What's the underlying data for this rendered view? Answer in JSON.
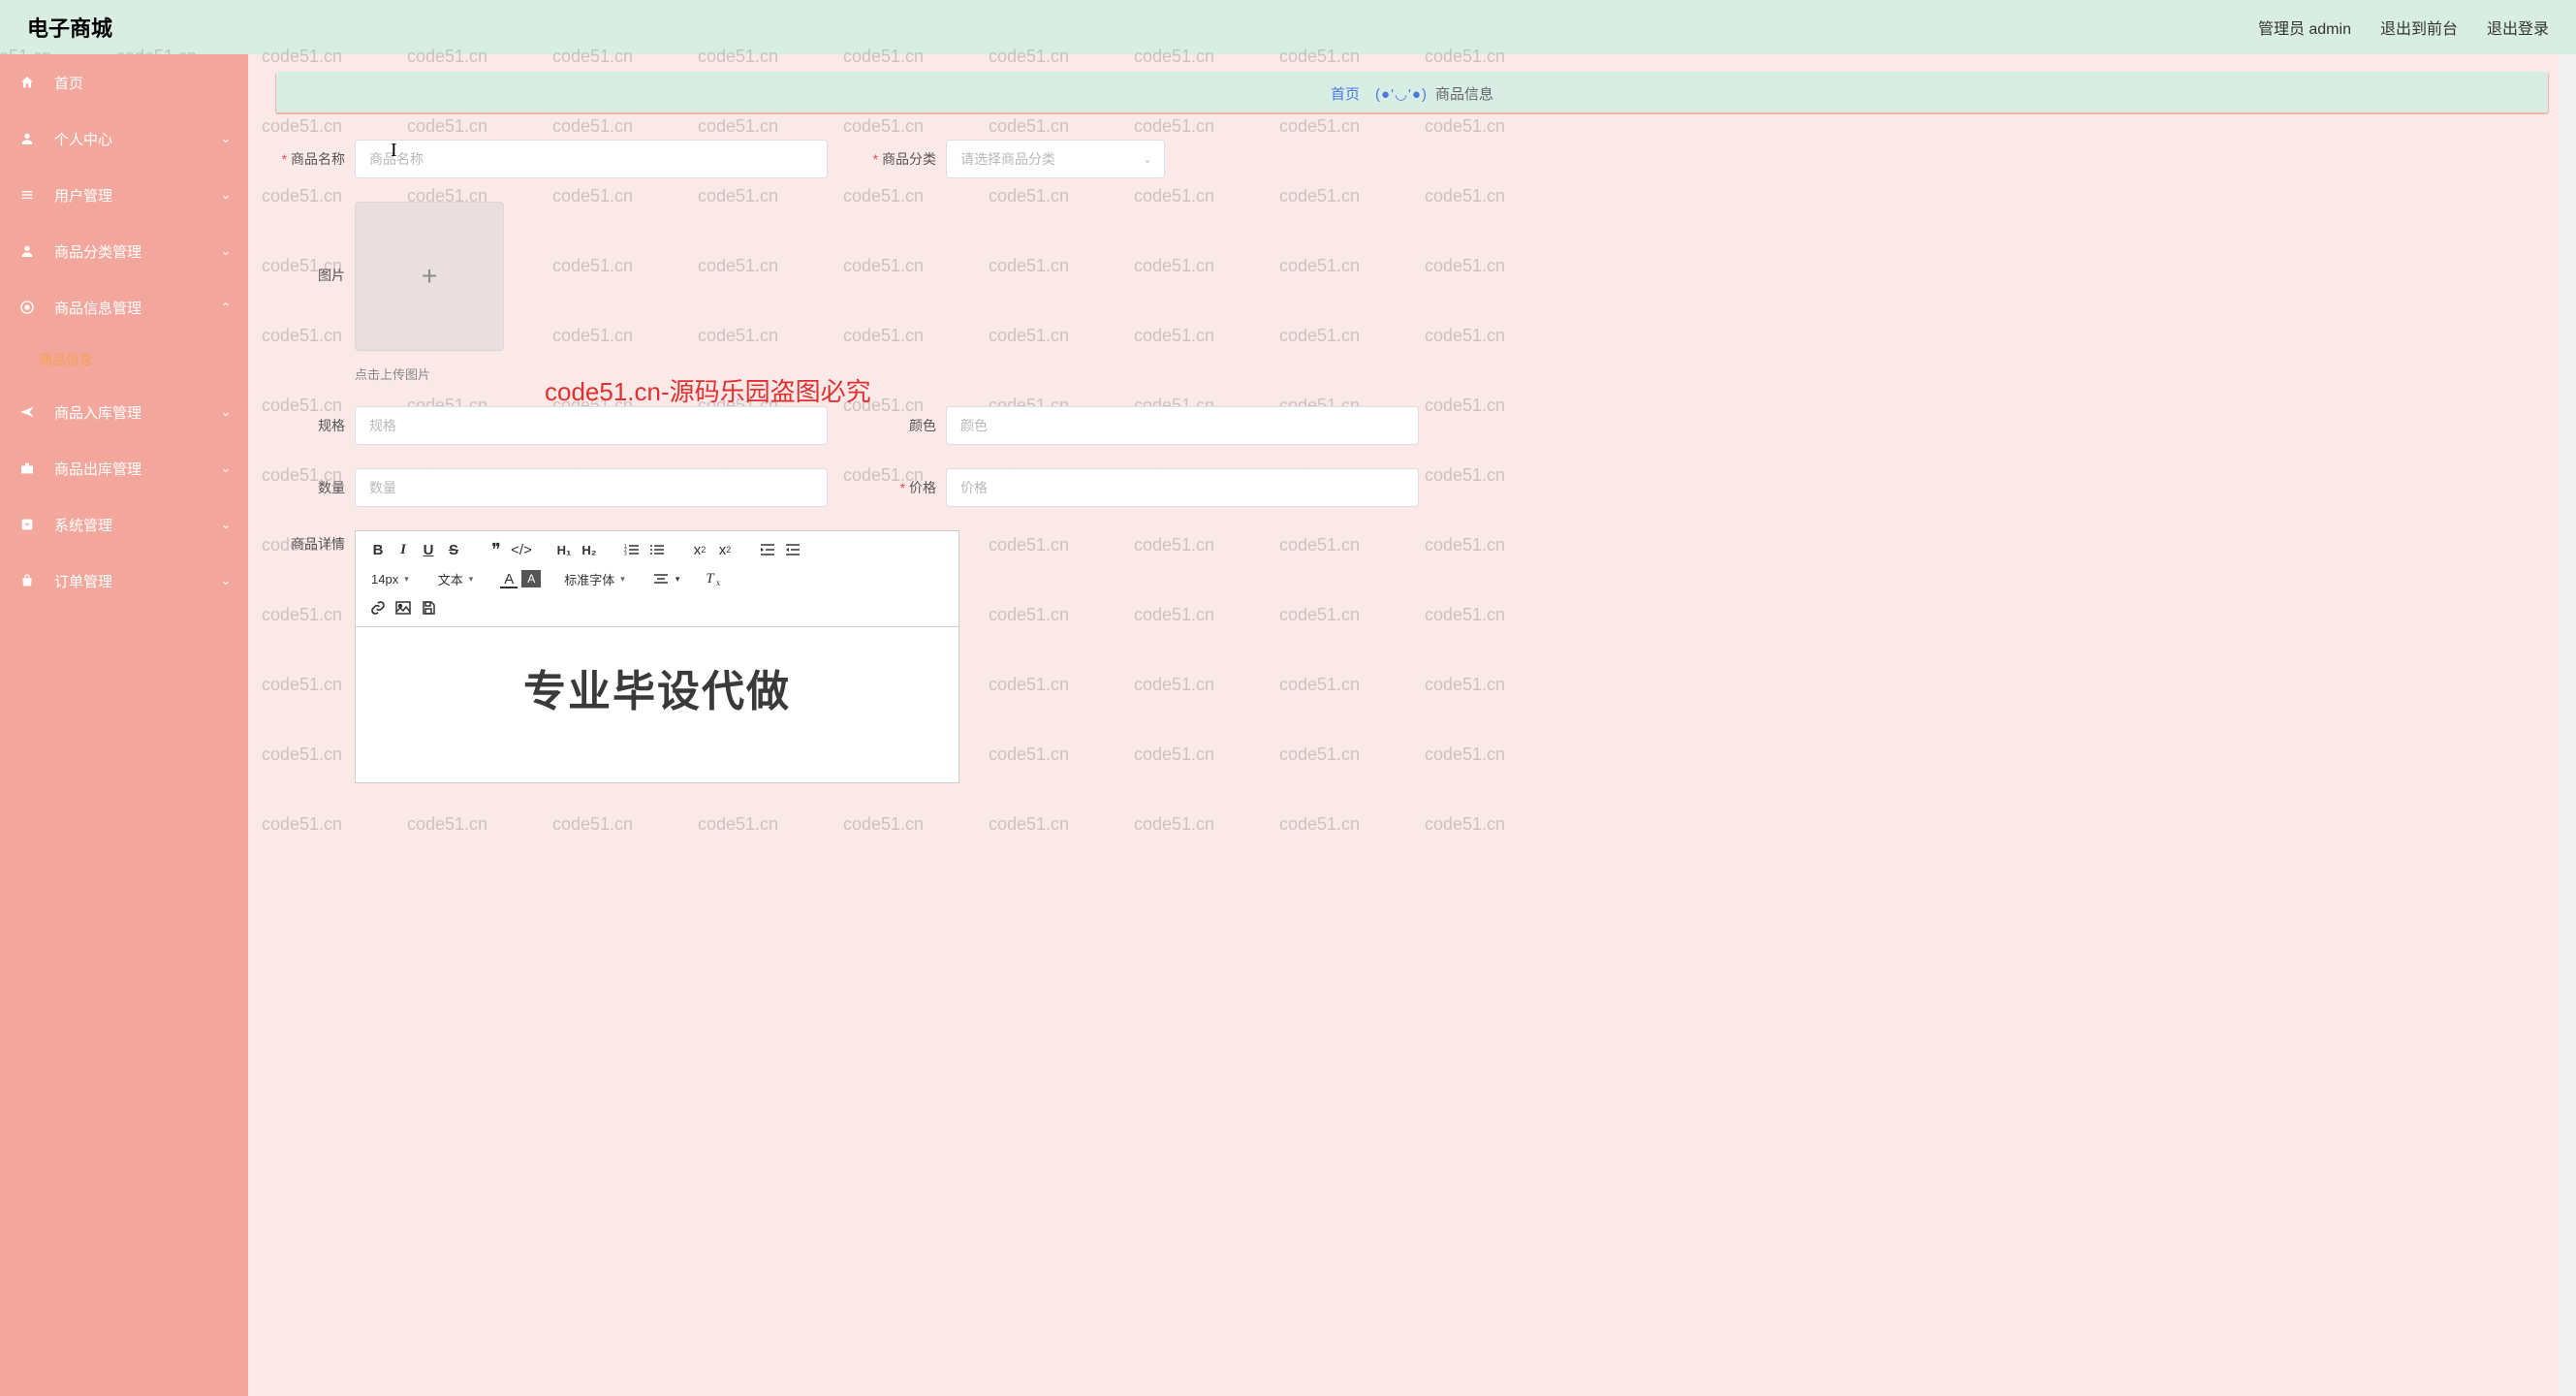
{
  "header": {
    "title": "电子商城",
    "admin_label": "管理员 admin",
    "exit_front": "退出到前台",
    "logout": "退出登录"
  },
  "sidebar": {
    "items": [
      {
        "icon": "home",
        "label": "首页",
        "expandable": false
      },
      {
        "icon": "user",
        "label": "个人中心",
        "expandable": true
      },
      {
        "icon": "list",
        "label": "用户管理",
        "expandable": true
      },
      {
        "icon": "user",
        "label": "商品分类管理",
        "expandable": true
      },
      {
        "icon": "record",
        "label": "商品信息管理",
        "expandable": true,
        "expanded": true,
        "children": [
          {
            "label": "商品信息",
            "active": true
          }
        ]
      },
      {
        "icon": "plane",
        "label": "商品入库管理",
        "expandable": true
      },
      {
        "icon": "briefcase",
        "label": "商品出库管理",
        "expandable": true
      },
      {
        "icon": "box",
        "label": "系统管理",
        "expandable": true
      },
      {
        "icon": "bag",
        "label": "订单管理",
        "expandable": true
      }
    ]
  },
  "breadcrumb": {
    "home": "首页",
    "face": "(●'◡'●)",
    "current": "商品信息"
  },
  "form": {
    "product_name": {
      "label": "商品名称",
      "placeholder": "商品名称"
    },
    "category": {
      "label": "商品分类",
      "placeholder": "请选择商品分类"
    },
    "image": {
      "label": "图片",
      "hint": "点击上传图片"
    },
    "spec": {
      "label": "规格",
      "placeholder": "规格"
    },
    "color": {
      "label": "颜色",
      "placeholder": "颜色"
    },
    "quantity": {
      "label": "数量",
      "placeholder": "数量"
    },
    "price": {
      "label": "价格",
      "placeholder": "价格"
    },
    "detail": {
      "label": "商品详情"
    }
  },
  "editor": {
    "font_size": "14px",
    "block_type": "文本",
    "font_family": "标准字体",
    "content": "专业毕设代做"
  },
  "watermark": {
    "text": "code51.cn",
    "long": "code51.cn-源码乐园盗图必究"
  }
}
